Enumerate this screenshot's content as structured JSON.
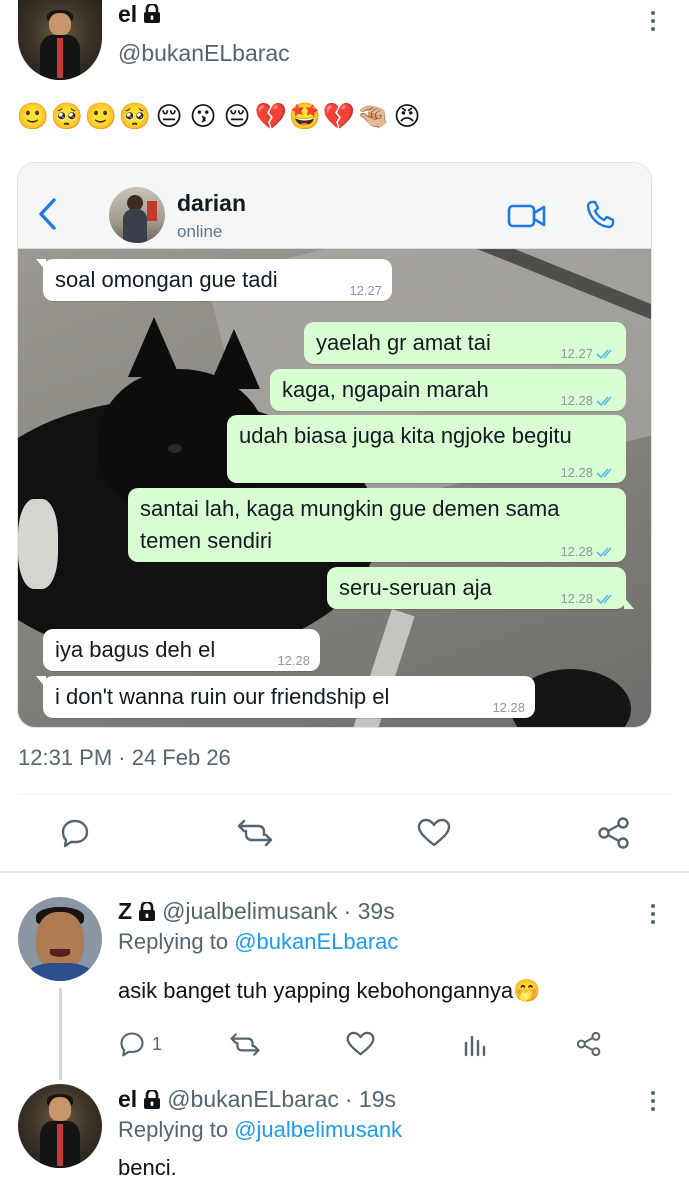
{
  "tweet": {
    "author_name": "el",
    "author_handle": "@bukanELbarac",
    "emoji_text": "🙂🥺🙂🥺😔😗😔💔🤩💔🤏🏼😠",
    "emojis": [
      "🙂",
      "🥺",
      "🙂",
      "🥺",
      "😔",
      "😗",
      "😔",
      "💔",
      "🤩",
      "💔",
      "🤏🏼",
      "😠"
    ],
    "timestamp": "12:31 PM · 24 Feb 26"
  },
  "chat": {
    "contact_name": "darian",
    "status": "online",
    "messages": [
      {
        "dir": "in",
        "text": "soal omongan gue tadi",
        "time": "12.27"
      },
      {
        "dir": "out",
        "text": "yaelah gr amat tai",
        "time": "12.27"
      },
      {
        "dir": "out",
        "text": "kaga, ngapain marah",
        "time": "12.28"
      },
      {
        "dir": "out",
        "text": "udah biasa juga kita ngjoke begitu",
        "time": "12.28"
      },
      {
        "dir": "out",
        "text": "santai lah, kaga mungkin gue demen sama",
        "text2": "temen sendiri",
        "time": "12.28"
      },
      {
        "dir": "out",
        "text": "seru-seruan aja",
        "time": "12.28"
      },
      {
        "dir": "in",
        "text": "iya bagus deh el",
        "time": "12.28"
      },
      {
        "dir": "in",
        "text": "i don't wanna ruin our friendship el",
        "time": "12.28"
      }
    ]
  },
  "actions": {
    "reply": "reply",
    "retweet": "retweet",
    "like": "like",
    "share": "share"
  },
  "replies": [
    {
      "name": "Z",
      "handle": "@jualbelimusank",
      "age": "· 39s",
      "replying_label": "Replying to",
      "replying_to": "@bukanELbarac",
      "text": "asik banget tuh yapping kebohongannya🤭",
      "reply_count": "1"
    },
    {
      "name": "el",
      "handle": "@bukanELbarac",
      "age": "· 19s",
      "replying_label": "Replying to",
      "replying_to": "@jualbelimusank",
      "text": "benci."
    }
  ],
  "colors": {
    "link": "#1d9bf0",
    "secondary_text": "#536471",
    "outgoing_bubble": "#d9fdd3",
    "ios_blue": "#1f7ae0"
  }
}
